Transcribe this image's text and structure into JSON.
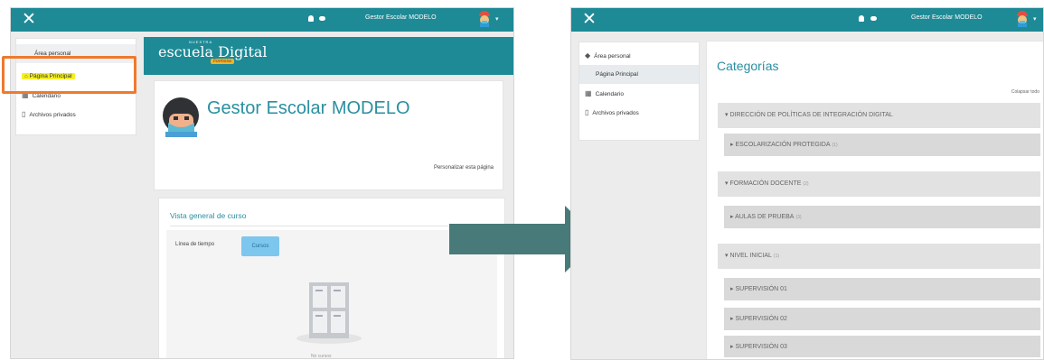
{
  "colors": {
    "topbar": "#1e8a96",
    "callout": "#ee7a2d",
    "highlight": "#f5ef24",
    "arrow": "#477a78",
    "button": "#7dc6ee"
  },
  "topbar": {
    "close_icon": "✕",
    "user_name": "Gestor Escolar MODELO",
    "notification_icon": "bell-icon",
    "message_icon": "chat-icon"
  },
  "before": {
    "nav": {
      "area_personal": "Área personal",
      "pagina_principal": "Página Principal",
      "calendario": "Calendario",
      "archivos": "Archivos privados"
    },
    "header": {
      "logo_small": "NUESTRA",
      "logo_main": "escuela Digital",
      "logo_badge": "Formosa"
    },
    "profile": {
      "name": "Gestor Escolar MODELO",
      "customize": "Personalizar esta página"
    },
    "course_overview": {
      "title": "Vista general de curso",
      "tab_timeline": "Línea de tiempo",
      "tab_courses": "Cursos",
      "empty_text": "No cursos"
    }
  },
  "after": {
    "nav": {
      "area_personal": "Área personal",
      "pagina_principal": "Página Principal",
      "calendario": "Calendario",
      "archivos": "Archivos privados"
    },
    "page_title": "Categorías",
    "collapse_all": "Colapsar todo",
    "categories": [
      {
        "label": "DIRECCIÓN DE POLÍTICAS DE INTEGRACIÓN DIGITAL",
        "count": ""
      },
      {
        "label": "ESCOLARIZACIÓN PROTEGIDA",
        "count": "(1)"
      },
      {
        "label": "FORMACIÓN DOCENTE",
        "count": "(2)"
      },
      {
        "label": "AULAS DE PRUEBA",
        "count": "(3)"
      },
      {
        "label": "NIVEL INICIAL",
        "count": "(1)"
      },
      {
        "label": "SUPERVISIÓN 01",
        "count": ""
      },
      {
        "label": "SUPERVISIÓN 02",
        "count": ""
      },
      {
        "label": "SUPERVISIÓN 03",
        "count": ""
      }
    ]
  }
}
